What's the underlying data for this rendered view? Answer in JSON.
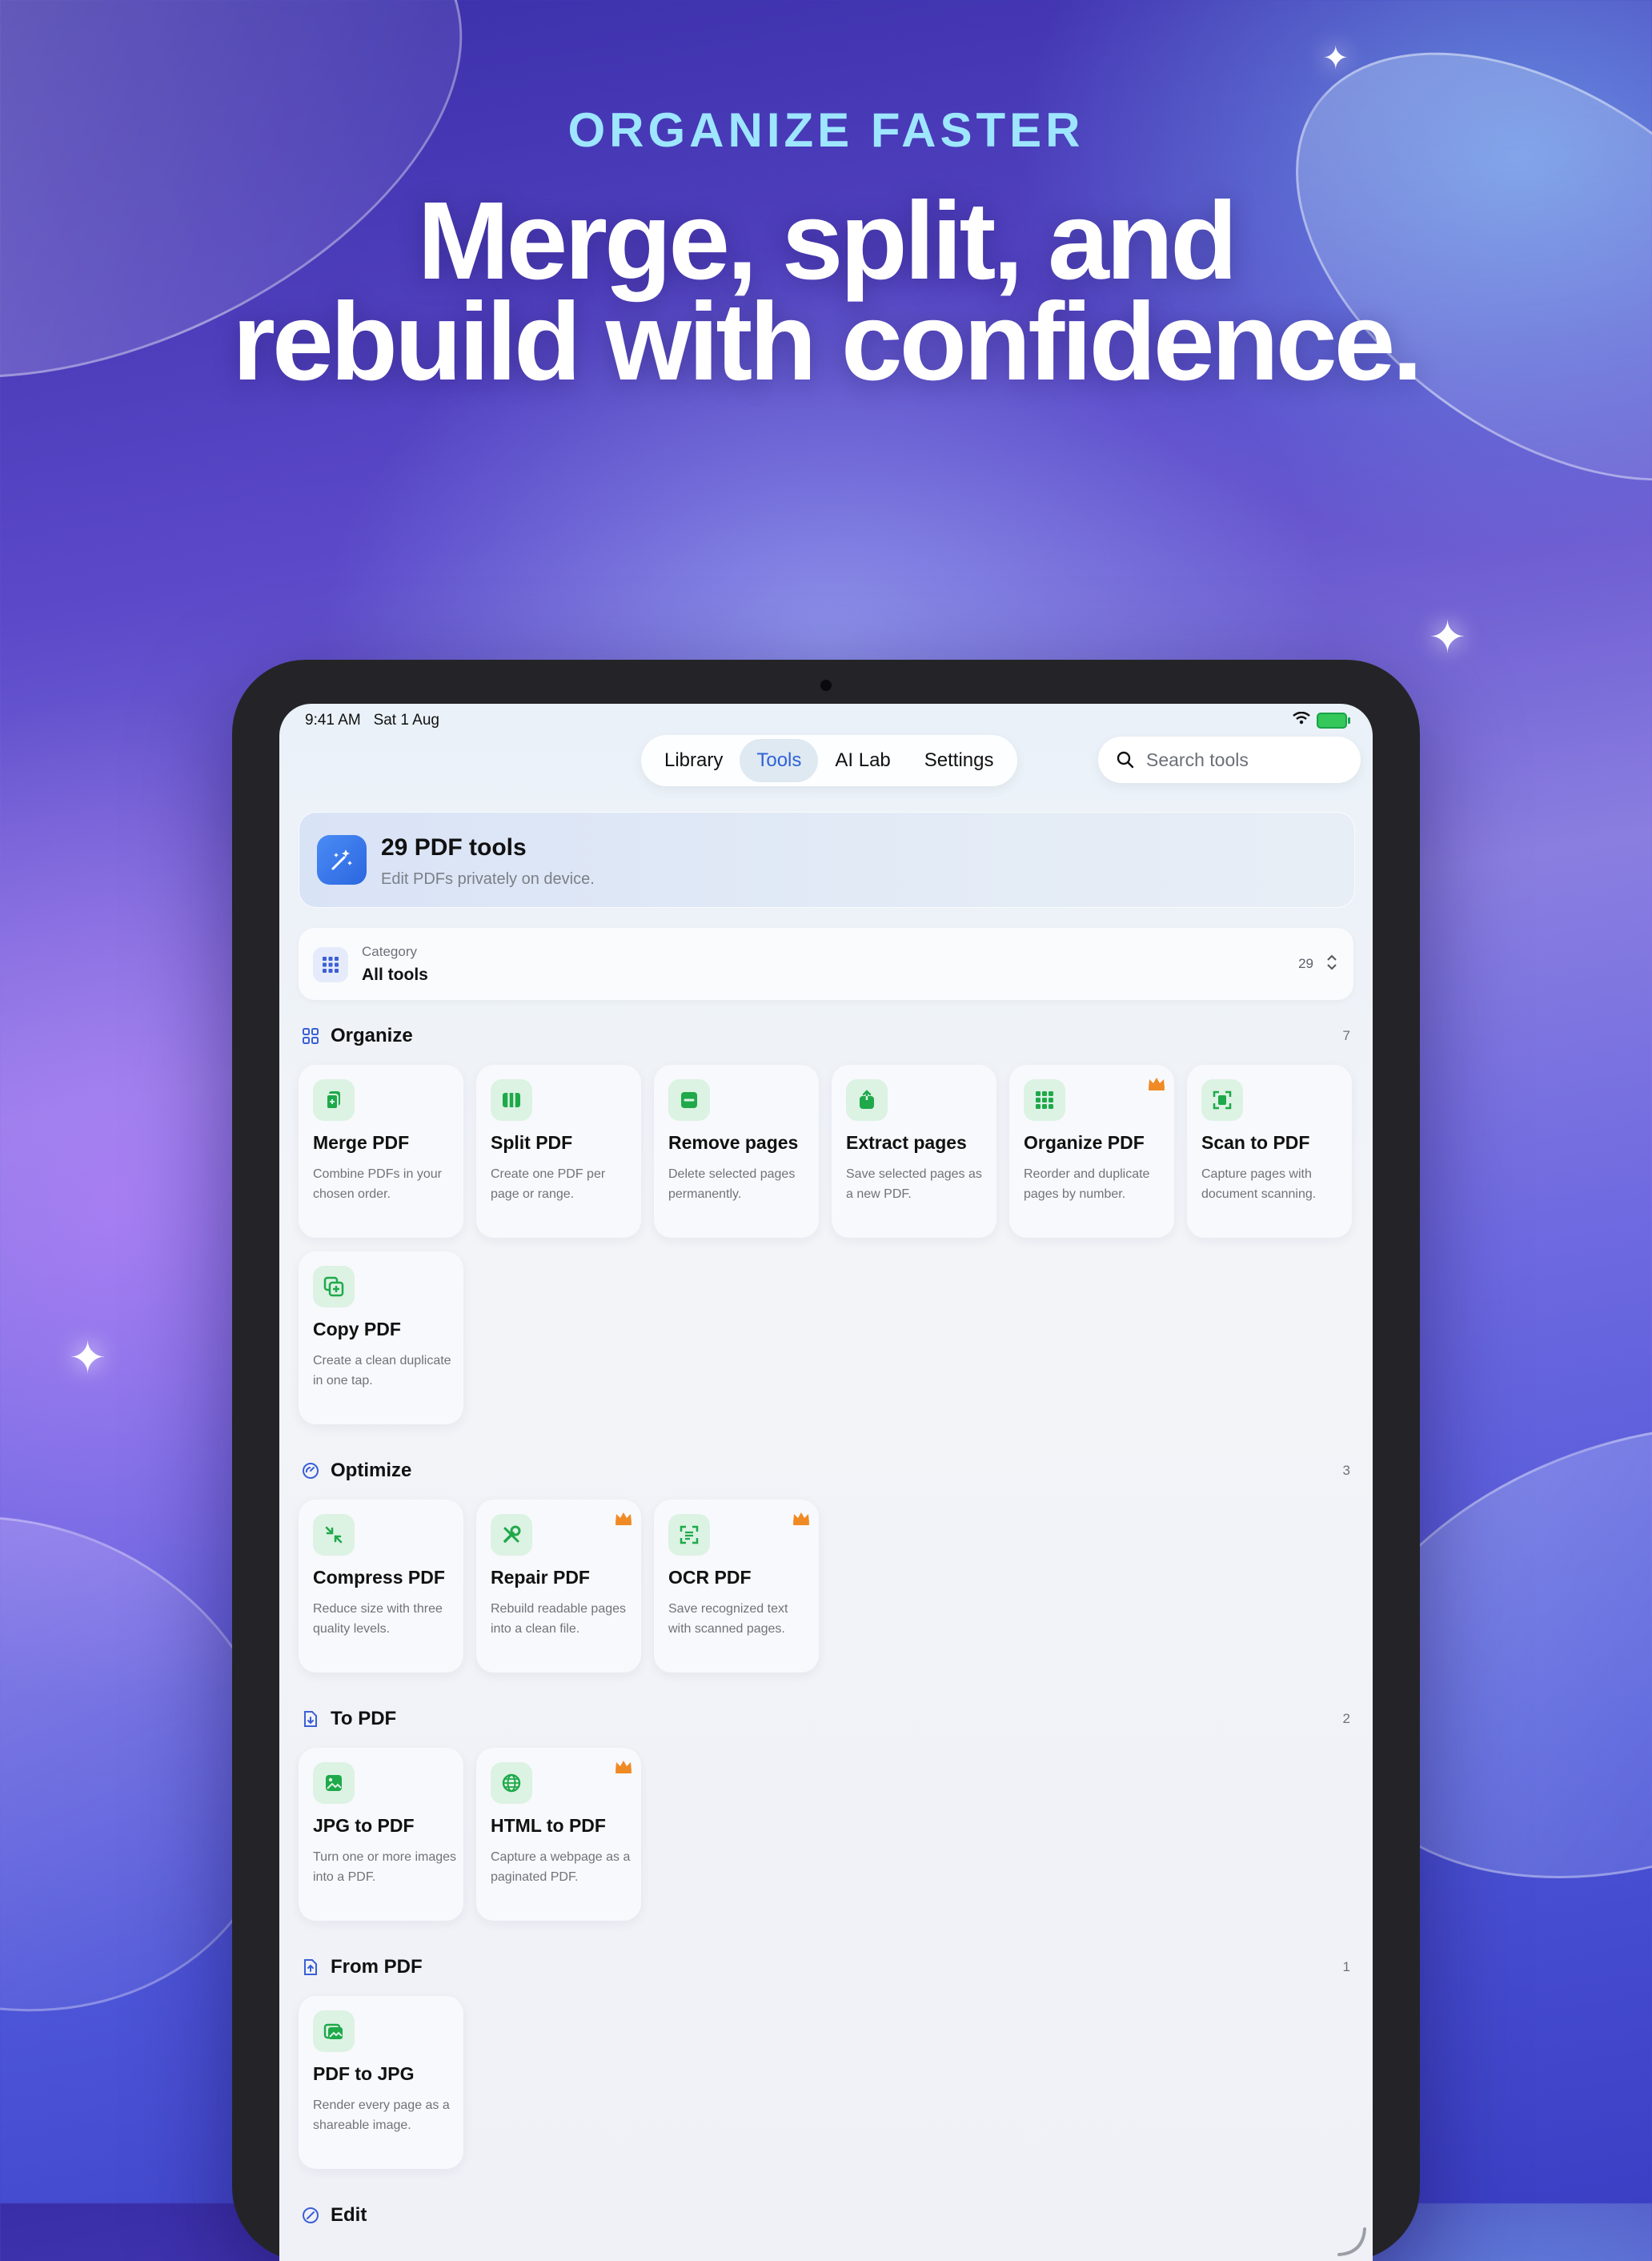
{
  "promo": {
    "eyebrow": "ORGANIZE FASTER",
    "headline_line1": "Merge, split, and",
    "headline_line2": "rebuild with confidence."
  },
  "status_bar": {
    "time": "9:41 AM",
    "date": "Sat 1 Aug"
  },
  "nav": {
    "tabs": [
      {
        "label": "Library",
        "active": false
      },
      {
        "label": "Tools",
        "active": true
      },
      {
        "label": "AI Lab",
        "active": false
      },
      {
        "label": "Settings",
        "active": false
      }
    ],
    "search_placeholder": "Search tools"
  },
  "hero": {
    "title": "29 PDF tools",
    "subtitle": "Edit PDFs privately on device.",
    "icon": "magic-wand-icon"
  },
  "category": {
    "label": "Category",
    "value": "All tools",
    "count": "29",
    "icon": "grid-icon"
  },
  "colors": {
    "accent": "#2e62d6",
    "tool_icon_bg": "#dcf2e3",
    "tool_icon_fg": "#1fa94a",
    "premium": "#f08a24"
  },
  "sections": [
    {
      "title": "Organize",
      "count": "7",
      "icon": "grid-squares-icon",
      "tools": [
        {
          "title": "Merge PDF",
          "desc": "Combine PDFs in your chosen order.",
          "icon": "merge-icon",
          "premium": false
        },
        {
          "title": "Split PDF",
          "desc": "Create one PDF per page or range.",
          "icon": "split-columns-icon",
          "premium": false
        },
        {
          "title": "Remove pages",
          "desc": "Delete selected pages permanently.",
          "icon": "minus-square-icon",
          "premium": false
        },
        {
          "title": "Extract pages",
          "desc": "Save selected pages as a new PDF.",
          "icon": "extract-icon",
          "premium": false
        },
        {
          "title": "Organize PDF",
          "desc": "Reorder and duplicate pages by number.",
          "icon": "grid-dots-icon",
          "premium": true
        },
        {
          "title": "Scan to PDF",
          "desc": "Capture pages with document scanning.",
          "icon": "scan-icon",
          "premium": false
        },
        {
          "title": "Copy PDF",
          "desc": "Create a clean duplicate in one tap.",
          "icon": "copy-plus-icon",
          "premium": false
        }
      ]
    },
    {
      "title": "Optimize",
      "count": "3",
      "icon": "gauge-icon",
      "tools": [
        {
          "title": "Compress PDF",
          "desc": "Reduce size with three quality levels.",
          "icon": "compress-arrows-icon",
          "premium": false
        },
        {
          "title": "Repair PDF",
          "desc": "Rebuild readable pages into a clean file.",
          "icon": "wrench-icon",
          "premium": true
        },
        {
          "title": "OCR PDF",
          "desc": "Save recognized text with scanned pages.",
          "icon": "text-scan-icon",
          "premium": true
        }
      ]
    },
    {
      "title": "To PDF",
      "count": "2",
      "icon": "doc-download-icon",
      "tools": [
        {
          "title": "JPG to PDF",
          "desc": "Turn one or more images into a PDF.",
          "icon": "image-icon",
          "premium": false
        },
        {
          "title": "HTML to PDF",
          "desc": "Capture a webpage as a paginated PDF.",
          "icon": "globe-icon",
          "premium": true
        }
      ]
    },
    {
      "title": "From PDF",
      "count": "1",
      "icon": "doc-upload-icon",
      "tools": [
        {
          "title": "PDF to JPG",
          "desc": "Render every page as a shareable image.",
          "icon": "images-icon",
          "premium": false
        }
      ]
    },
    {
      "title": "Edit",
      "count": "",
      "icon": "edit-icon",
      "tools": []
    }
  ]
}
